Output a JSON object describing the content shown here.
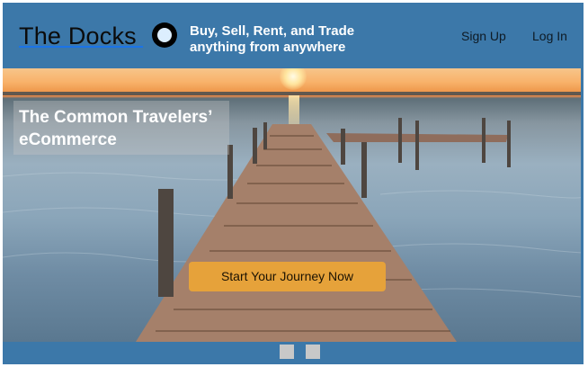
{
  "header": {
    "brand": "The Docks",
    "tagline": "Buy, Sell, Rent, and  Trade anything from anywhere",
    "nav": {
      "signup_label": "Sign Up",
      "login_label": "Log In"
    }
  },
  "hero": {
    "title": "The Common Travelers’ eCommerce",
    "cta_label": "Start Your Journey Now"
  },
  "carousel": {
    "slide_count": 2
  },
  "colors": {
    "header_bg": "#3c78a9",
    "cta_bg": "#e6a23a",
    "tagline_text": "#ffffff"
  }
}
